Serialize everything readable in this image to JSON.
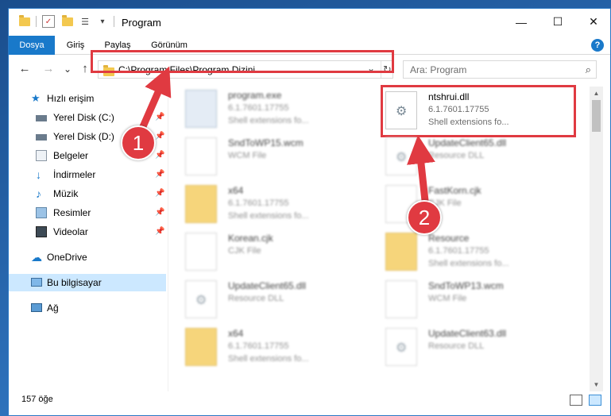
{
  "window": {
    "title": "Program"
  },
  "title_controls": {
    "minimize": "—",
    "maximize": "☐",
    "close": "✕"
  },
  "ribbon": {
    "tabs": [
      {
        "label": "Dosya",
        "active": true
      },
      {
        "label": "Giriş"
      },
      {
        "label": "Paylaş"
      },
      {
        "label": "Görünüm"
      }
    ],
    "help": "?"
  },
  "nav": {
    "back": "←",
    "forward": "→",
    "recent": "⌄",
    "up": "↑",
    "address": "C:\\Program Files\\Program Dizini",
    "address_dropdown": "⌄",
    "refresh": "↻",
    "search_placeholder": "Ara: Program",
    "search_icon": "⌕"
  },
  "sidebar": {
    "items": [
      {
        "label": "Hızlı erişim",
        "icon": "star-icon"
      },
      {
        "label": "Yerel Disk (C:)",
        "icon": "drive-icon",
        "pinned": true
      },
      {
        "label": "Yerel Disk (D:)",
        "icon": "drive-icon",
        "pinned": true
      },
      {
        "label": "Belgeler",
        "icon": "documents-icon",
        "pinned": true
      },
      {
        "label": "İndirmeler",
        "icon": "download-icon",
        "pinned": true
      },
      {
        "label": "Müzik",
        "icon": "music-icon",
        "pinned": true
      },
      {
        "label": "Resimler",
        "icon": "pictures-icon",
        "pinned": true
      },
      {
        "label": "Videolar",
        "icon": "video-icon",
        "pinned": true
      },
      {
        "label": "OneDrive",
        "icon": "cloud-icon"
      },
      {
        "label": "Bu bilgisayar",
        "icon": "computer-icon",
        "selected": true
      },
      {
        "label": "Ağ",
        "icon": "network-icon"
      }
    ],
    "pin_glyph": "📌"
  },
  "files": [
    {
      "name": "program.exe",
      "line2": "6.1.7601.17755",
      "line3": "Shell extensions fo...",
      "icon": "exe-icon",
      "blurred": true
    },
    {
      "name": "ntshrui.dll",
      "line2": "6.1.7601.17755",
      "line3": "Shell extensions fo...",
      "icon": "dll-icon",
      "highlighted": true
    },
    {
      "name": "SndToWP15.wcm",
      "line2": "WCM File",
      "line3": "",
      "icon": "document-icon",
      "blurred": true
    },
    {
      "name": "UpdateClient65.dll",
      "line2": "Resource DLL",
      "line3": "",
      "icon": "dll-icon",
      "blurred": true
    },
    {
      "name": "x64",
      "line2": "6.1.7601.17755",
      "line3": "Shell extensions fo...",
      "icon": "folder-icon",
      "blurred": true
    },
    {
      "name": "FastKorn.cjk",
      "line2": "CJK File",
      "line3": "",
      "icon": "document-icon",
      "blurred": true
    },
    {
      "name": "Korean.cjk",
      "line2": "CJK File",
      "line3": "",
      "icon": "document-icon",
      "blurred": true
    },
    {
      "name": "Resource",
      "line2": "6.1.7601.17755",
      "line3": "Shell extensions fo...",
      "icon": "folder-icon",
      "blurred": true
    },
    {
      "name": "UpdateClient65.dll",
      "line2": "Resource DLL",
      "line3": "",
      "icon": "dll-icon",
      "blurred": true
    },
    {
      "name": "SndToWP13.wcm",
      "line2": "WCM File",
      "line3": "",
      "icon": "document-icon",
      "blurred": true
    },
    {
      "name": "x64",
      "line2": "6.1.7601.17755",
      "line3": "Shell extensions fo...",
      "icon": "folder-icon",
      "blurred": true
    },
    {
      "name": "UpdateClient63.dll",
      "line2": "Resource DLL",
      "line3": "",
      "icon": "dll-icon",
      "blurred": true
    }
  ],
  "status": {
    "count": "157 öğe"
  },
  "callouts": [
    {
      "number": "1"
    },
    {
      "number": "2"
    }
  ],
  "colors": {
    "accent": "#1979ca",
    "callout": "#e03a41",
    "selected": "#cce8ff"
  }
}
